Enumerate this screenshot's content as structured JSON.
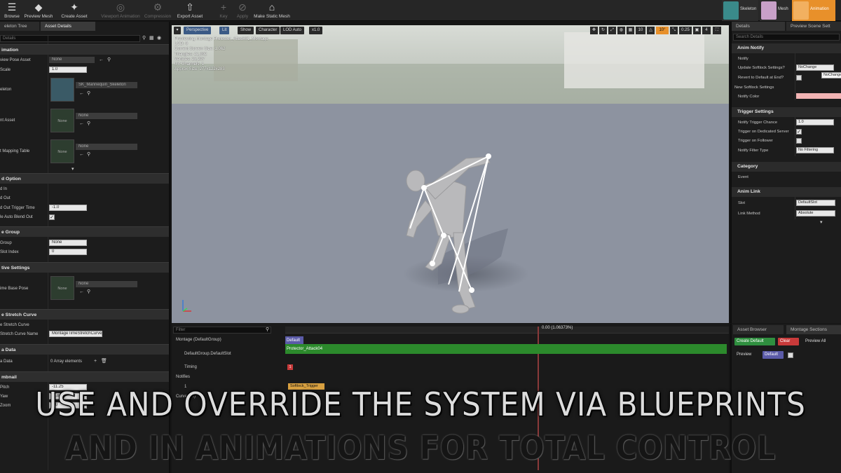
{
  "toolbar": {
    "buttons": [
      {
        "label": "Browse",
        "icon": "☰"
      },
      {
        "label": "Preview Mesh",
        "icon": "◆"
      },
      {
        "label": "Create Asset",
        "icon": "✦"
      },
      {
        "label": "Viewport Animation",
        "icon": "◎"
      },
      {
        "label": "Compression",
        "icon": "⚙"
      },
      {
        "label": "Export Asset",
        "icon": "⇧"
      },
      {
        "label": "Key",
        "icon": "+"
      },
      {
        "label": "Apply",
        "icon": "⊘"
      },
      {
        "label": "Make Static Mesh",
        "icon": "⌂"
      }
    ],
    "modes": [
      {
        "label": "Skeleton",
        "color": "#3a8a8a"
      },
      {
        "label": "Mesh",
        "color": "#c8a0c8"
      },
      {
        "label": "Animation",
        "color": "#e8902a"
      }
    ]
  },
  "left": {
    "tabs": [
      "eleton Tree",
      "Asset Details"
    ],
    "search_placeholder": "Details",
    "categories": {
      "animation": "imation",
      "blend_option": "d Option",
      "slot_group": "e Group",
      "additive": "tive Settings",
      "stretch": "e Stretch Curve",
      "meta": "a Data",
      "thumbnail": "mbnail"
    },
    "props": {
      "preview_pose": "view Pose Asset",
      "rate_scale": "Scale",
      "skeleton": "eleton",
      "parent_asset": "nt Asset",
      "mapping_table": "t Mapping Table",
      "blend_in": "d In",
      "blend_out": "d Out",
      "blend_out_trigger": "d Out Trigger Time",
      "auto_blend": "le Auto Blend Out",
      "slot_group": "Group",
      "slot_index": "Slot Index",
      "base_pose": "ime Base Pose",
      "stretch_curve": "e Stretch Curve",
      "stretch_curve_name": "Stretch Curve Name",
      "meta_data": "a Data",
      "orbit_pitch": "Pitch",
      "orbit_yaw": "Yaw",
      "orbit_zoom": "Zoom"
    },
    "values": {
      "preview_pose": "None",
      "rate_scale": "1.0",
      "skeleton_name": "SK_Mannequin_Skeleton",
      "none": "None",
      "blend_out_trigger": "-1.0",
      "slot_group": "None",
      "slot_index": "0",
      "stretch_curve_name": "MontageTimeStretchCurve",
      "array_elements": "0 Array elements",
      "pitch": "-11.25",
      "yaw": "-1.8",
      "zoom": "0.0"
    }
  },
  "viewport": {
    "buttons": [
      "Perspective",
      "Lit",
      "Show",
      "Character",
      "LOD Auto",
      "x1.0"
    ],
    "stats": [
      "Previewing Montage Protector_Attack01_Montage",
      "LOD: 0",
      "Current Screen Size: 1.062",
      "Triangles: 41,092",
      "Vertices: 23,297",
      "UV Channels: 1",
      "Approx Size: 277x122x283"
    ],
    "right_controls": [
      "10",
      "10°",
      "0.25",
      "4"
    ],
    "colors": {
      "sky": "#c9cdc9",
      "floor": "#8d93a0",
      "figure": "#b9b9bb",
      "bones": "#ffffff"
    }
  },
  "details": {
    "tabs": [
      "Details",
      "Preview Scene Sett"
    ],
    "search_placeholder": "Search Details",
    "anim_notify": {
      "title": "Anim Notify",
      "rows": [
        "Notify",
        "Update Softlock Settings?",
        "Revert to Default at End?",
        "New Softlock Settings",
        "Notify Color"
      ],
      "update_value": "NoChange",
      "tooltip": "NoChange"
    },
    "trigger": {
      "title": "Trigger Settings",
      "rows": [
        "Notify Trigger Chance",
        "Trigger on Dedicated Server",
        "Trigger on Follower",
        "Notify Filter Type"
      ],
      "chance": "1.0",
      "filter": "No Filtering"
    },
    "category": {
      "title": "Category",
      "row": "Event"
    },
    "anim_link": {
      "title": "Anim Link",
      "rows": [
        "Slot",
        "Link Method"
      ],
      "slot": "DefaultSlot",
      "method": "Absolute"
    }
  },
  "timeline": {
    "filter_placeholder": "Filter",
    "rows": [
      "Montage (DefaultGroup)",
      "DefaultGroup.DefaultSlot",
      "Timing",
      "Notifies",
      "1",
      "Curves (0)"
    ],
    "section_label": "Default",
    "segment_label": "Protector_Attack04",
    "timing_marker": "1",
    "notify_label": "Softlock_Trigger",
    "time_readout": "0.00 (1.06373%)"
  },
  "asset_browser": {
    "tabs": [
      "Asset Browser",
      "Montage Sections"
    ],
    "create_default": "Create Default",
    "clear": "Clear",
    "preview_all": "Preview All",
    "preview": "Preview",
    "default": "Default"
  },
  "caption": {
    "line1": "USE AND OVERRIDE THE SYSTEM VIA BLUEPRINTS",
    "line2": "AND IN ANIMATIONS FOR TOTAL CONTROL"
  }
}
